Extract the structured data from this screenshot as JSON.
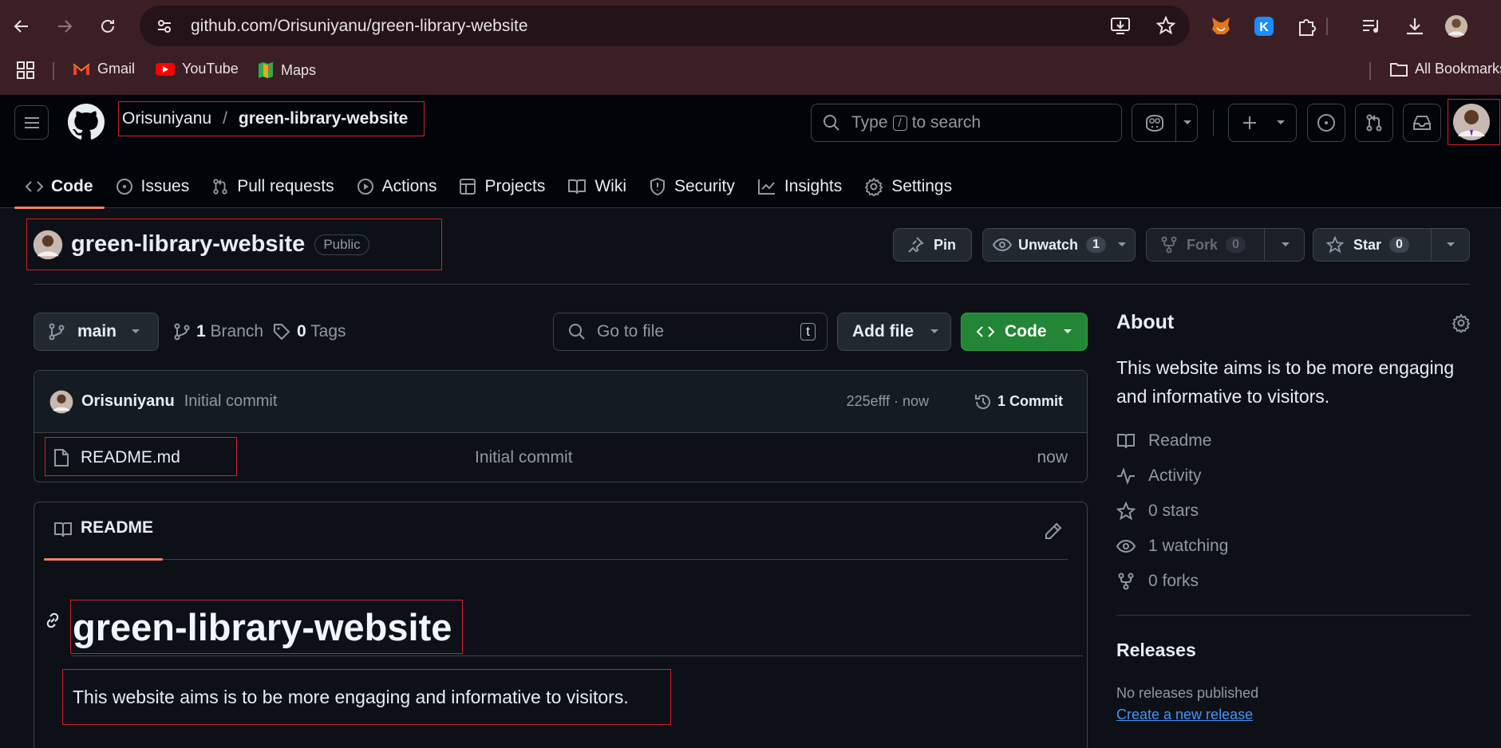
{
  "browser": {
    "url": "github.com/Orisuniyanu/green-library-website",
    "bookmarks": [
      {
        "label": "Gmail"
      },
      {
        "label": "YouTube"
      },
      {
        "label": "Maps"
      }
    ],
    "all_bookmarks": "All Bookmarks"
  },
  "header": {
    "owner": "Orisuniyanu",
    "separator": "/",
    "repo": "green-library-website",
    "search_type": "Type",
    "search_key": "/",
    "search_rest": "to search"
  },
  "tabs": [
    {
      "label": "Code"
    },
    {
      "label": "Issues"
    },
    {
      "label": "Pull requests"
    },
    {
      "label": "Actions"
    },
    {
      "label": "Projects"
    },
    {
      "label": "Wiki"
    },
    {
      "label": "Security"
    },
    {
      "label": "Insights"
    },
    {
      "label": "Settings"
    }
  ],
  "repo": {
    "name": "green-library-website",
    "visibility": "Public",
    "pin": "Pin",
    "unwatch": "Unwatch",
    "watch_count": "1",
    "fork": "Fork",
    "fork_count": "0",
    "star": "Star",
    "star_count": "0"
  },
  "toolbar": {
    "branch": "main",
    "branches_num": "1",
    "branches_label": "Branch",
    "tags_num": "0",
    "tags_label": "Tags",
    "goto_placeholder": "Go to file",
    "goto_key": "t",
    "add_file": "Add file",
    "code": "Code"
  },
  "commit": {
    "author": "Orisuniyanu",
    "message": "Initial commit",
    "hash_time": "225efff · now",
    "commits": "1 Commit"
  },
  "files": [
    {
      "name": "README.md",
      "message": "Initial commit",
      "time": "now"
    }
  ],
  "readme": {
    "tab": "README",
    "heading": "green-library-website",
    "body": "This website aims is to be more engaging and informative to visitors."
  },
  "about": {
    "title": "About",
    "description": "This website aims is to be more engaging and informative to visitors.",
    "items": [
      {
        "label": "Readme"
      },
      {
        "label": "Activity"
      },
      {
        "label": "0 stars"
      },
      {
        "label": "1 watching"
      },
      {
        "label": "0 forks"
      }
    ],
    "releases_title": "Releases",
    "no_releases": "No releases published",
    "create_release": "Create a new release"
  },
  "colors": {
    "chrome_bg": "#3c1f25",
    "gh_bg": "#0d1117",
    "accent_tab": "#f78166",
    "code_button": "#238636",
    "link": "#4493f8",
    "highlight_box": "#d0202a"
  }
}
